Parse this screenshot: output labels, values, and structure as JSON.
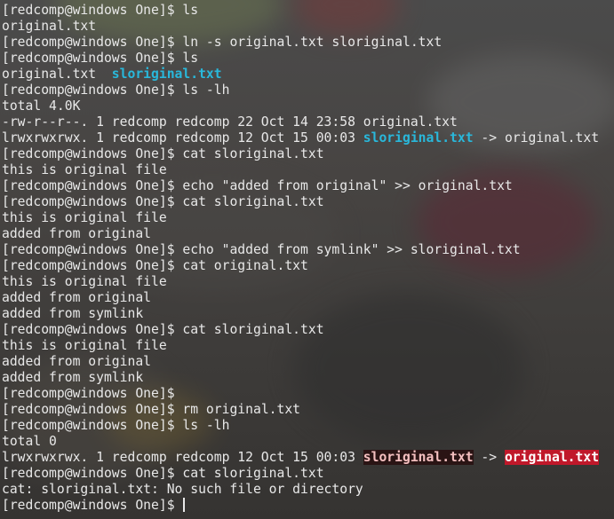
{
  "prompt": "[redcomp@windows One]$",
  "lines": [
    {
      "type": "cmd",
      "text": "ls"
    },
    {
      "type": "out",
      "text": "original.txt"
    },
    {
      "type": "cmd",
      "text": "ln -s original.txt sloriginal.txt"
    },
    {
      "type": "cmd",
      "text": "ls"
    },
    {
      "type": "out-link",
      "text": "original.txt  ",
      "link": "sloriginal.txt"
    },
    {
      "type": "cmd",
      "text": "ls -lh"
    },
    {
      "type": "out",
      "text": "total 4.0K"
    },
    {
      "type": "out",
      "text": "-rw-r--r--. 1 redcomp redcomp 22 Oct 14 23:58 original.txt"
    },
    {
      "type": "out-longlink",
      "prefix": "lrwxrwxrwx. 1 redcomp redcomp 12 Oct 15 00:03 ",
      "link": "sloriginal.txt",
      "arrow": " -> ",
      "target": "original.txt"
    },
    {
      "type": "cmd",
      "text": "cat sloriginal.txt"
    },
    {
      "type": "out",
      "text": "this is original file"
    },
    {
      "type": "cmd",
      "text": "echo \"added from original\" >> original.txt"
    },
    {
      "type": "cmd",
      "text": "cat sloriginal.txt"
    },
    {
      "type": "out",
      "text": "this is original file"
    },
    {
      "type": "out",
      "text": "added from original"
    },
    {
      "type": "cmd",
      "text": "echo \"added from symlink\" >> sloriginal.txt"
    },
    {
      "type": "cmd",
      "text": "cat original.txt"
    },
    {
      "type": "out",
      "text": "this is original file"
    },
    {
      "type": "out",
      "text": "added from original"
    },
    {
      "type": "out",
      "text": "added from symlink"
    },
    {
      "type": "cmd",
      "text": "cat sloriginal.txt"
    },
    {
      "type": "out",
      "text": "this is original file"
    },
    {
      "type": "out",
      "text": "added from original"
    },
    {
      "type": "out",
      "text": "added from symlink"
    },
    {
      "type": "cmd",
      "text": ""
    },
    {
      "type": "cmd",
      "text": "rm original.txt"
    },
    {
      "type": "cmd",
      "text": "ls -lh"
    },
    {
      "type": "out",
      "text": "total 0"
    },
    {
      "type": "out-brokenlink",
      "prefix": "lrwxrwxrwx. 1 redcomp redcomp 12 Oct 15 00:03 ",
      "link": "sloriginal.txt",
      "arrow": " -> ",
      "target": "original.txt"
    },
    {
      "type": "cmd",
      "text": "cat sloriginal.txt"
    },
    {
      "type": "out",
      "text": "cat: sloriginal.txt: No such file or directory"
    },
    {
      "type": "prompt-cursor",
      "text": ""
    }
  ],
  "colors": {
    "text": "#e8e8e8",
    "symlink": "#29b8db",
    "broken_target_bg": "#c0182a"
  }
}
